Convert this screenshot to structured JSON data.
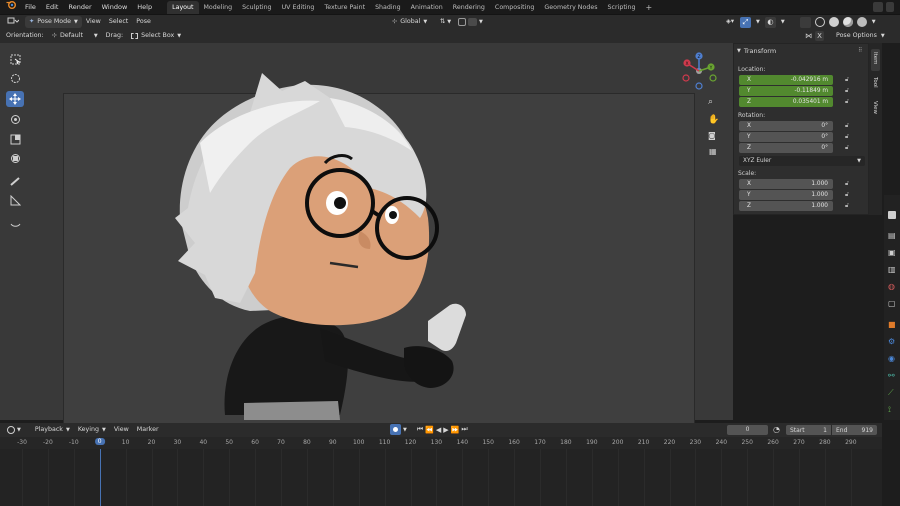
{
  "menu": {
    "items": [
      "File",
      "Edit",
      "Render",
      "Window",
      "Help"
    ],
    "workspaces": [
      "Layout",
      "Modeling",
      "Sculpting",
      "UV Editing",
      "Texture Paint",
      "Shading",
      "Animation",
      "Rendering",
      "Compositing",
      "Geometry Nodes",
      "Scripting"
    ],
    "active_workspace": "Layout",
    "add_tab": "+"
  },
  "header": {
    "mode": "Pose Mode",
    "view": "View",
    "select": "Select",
    "pose": "Pose",
    "transform_orientation": "Global"
  },
  "toolheader": {
    "orientation_label": "Orientation:",
    "orientation_value": "Default",
    "drag_label": "Drag:",
    "drag_value": "Select Box",
    "x_mirror": "X",
    "pose_options": "Pose Options"
  },
  "npanel": {
    "title": "Transform",
    "location_label": "Location:",
    "location": [
      {
        "axis": "X",
        "value": "-0.042916 m"
      },
      {
        "axis": "Y",
        "value": "-0.11849 m"
      },
      {
        "axis": "Z",
        "value": "0.035401 m"
      }
    ],
    "rotation_label": "Rotation:",
    "rotation": [
      {
        "axis": "X",
        "value": "0°"
      },
      {
        "axis": "Y",
        "value": "0°"
      },
      {
        "axis": "Z",
        "value": "0°"
      }
    ],
    "rotation_mode": "XYZ Euler",
    "scale_label": "Scale:",
    "scale": [
      {
        "axis": "X",
        "value": "1.000"
      },
      {
        "axis": "Y",
        "value": "1.000"
      },
      {
        "axis": "Z",
        "value": "1.000"
      }
    ],
    "tabs": [
      "Item",
      "Tool",
      "View"
    ]
  },
  "timeline": {
    "playback": "Playback",
    "keying": "Keying",
    "view": "View",
    "marker": "Marker",
    "current_frame": "0",
    "start_label": "Start",
    "start": "1",
    "end_label": "End",
    "end": "919",
    "ruler": [
      "-30",
      "-20",
      "-10",
      "0",
      "10",
      "20",
      "30",
      "40",
      "50",
      "60",
      "70",
      "80",
      "90",
      "100",
      "110",
      "120",
      "130",
      "140",
      "150",
      "160",
      "170",
      "180",
      "190",
      "200",
      "210",
      "220",
      "230",
      "240",
      "250",
      "260",
      "270",
      "280",
      "290"
    ]
  },
  "gizmo": {
    "x": "X",
    "y": "Y",
    "z": "Z"
  }
}
